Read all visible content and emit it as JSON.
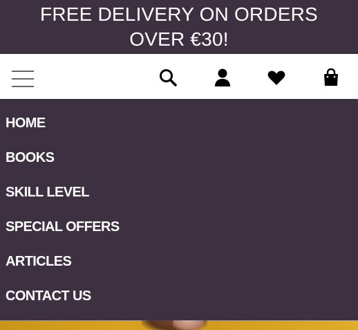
{
  "promo": {
    "line1": "FREE DELIVERY ON ORDERS",
    "line2": "OVER €30!"
  },
  "toolbar": {
    "icons": [
      "menu-icon",
      "search-icon",
      "user-icon",
      "heart-icon",
      "bag-icon"
    ]
  },
  "menu": {
    "items": [
      "HOME",
      "BOOKS",
      "SKILL LEVEL",
      "SPECIAL OFFERS",
      "ARTICLES",
      "CONTACT US"
    ]
  },
  "colors": {
    "brand_dark": "#3d3041",
    "toolbar_bg": "#ffffff",
    "hero_gold": "#d9a320"
  }
}
